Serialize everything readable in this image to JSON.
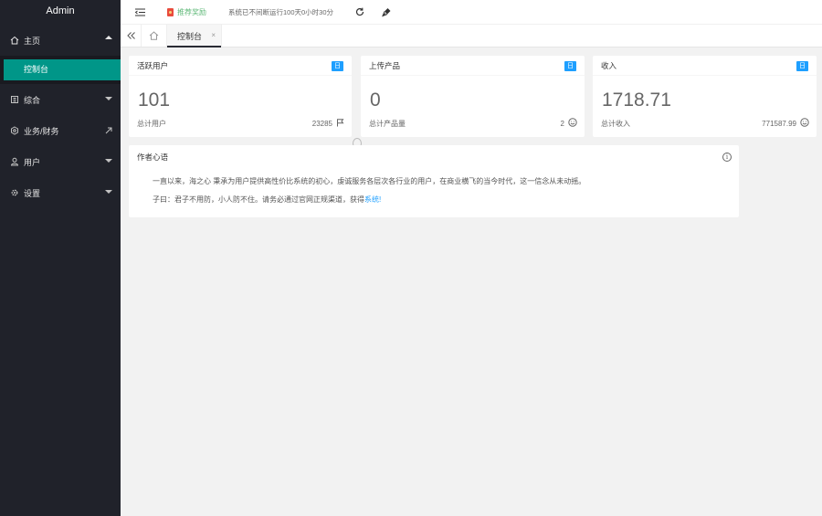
{
  "sidebar": {
    "logo": "Admin",
    "groups": [
      {
        "label": "主页",
        "icon": "home-icon",
        "expanded": true
      },
      {
        "label": "综合",
        "icon": "grid-icon"
      },
      {
        "label": "业务/财务",
        "icon": "settings-icon"
      },
      {
        "label": "用户",
        "icon": "user-icon"
      },
      {
        "label": "设置",
        "icon": "gear-icon"
      }
    ],
    "active_sub": "控制台"
  },
  "header": {
    "promo": "推荐奖励",
    "uptime": "系统已不间断运行100天0小时30分"
  },
  "tabs": {
    "active": "控制台",
    "close": "×"
  },
  "cards": [
    {
      "title": "活跃用户",
      "badge": "日",
      "value": "101",
      "foot_label": "总计用户",
      "foot_value": "23285"
    },
    {
      "title": "上传产品",
      "badge": "日",
      "value": "0",
      "foot_label": "总计产品量",
      "foot_value": "2"
    },
    {
      "title": "收入",
      "badge": "日",
      "value": "1718.71",
      "foot_label": "总计收入",
      "foot_value": "771587.99"
    }
  ],
  "author": {
    "title": "作者心语",
    "line1": "一直以来，海之心 秉承为用户提供高性价比系统的初心，虔诚服务各层次各行业的用户，在商业横飞的当今时代，这一信念从未动摇。",
    "line2_prefix": "子曰：君子不用防，小人防不住。请务必通过官网正规渠道，获得",
    "line2_link": "系统!"
  },
  "colors": {
    "sidebar_bg": "#20222a",
    "accent": "#009688",
    "badge": "#1e9fff",
    "promo": "#5fb878"
  }
}
